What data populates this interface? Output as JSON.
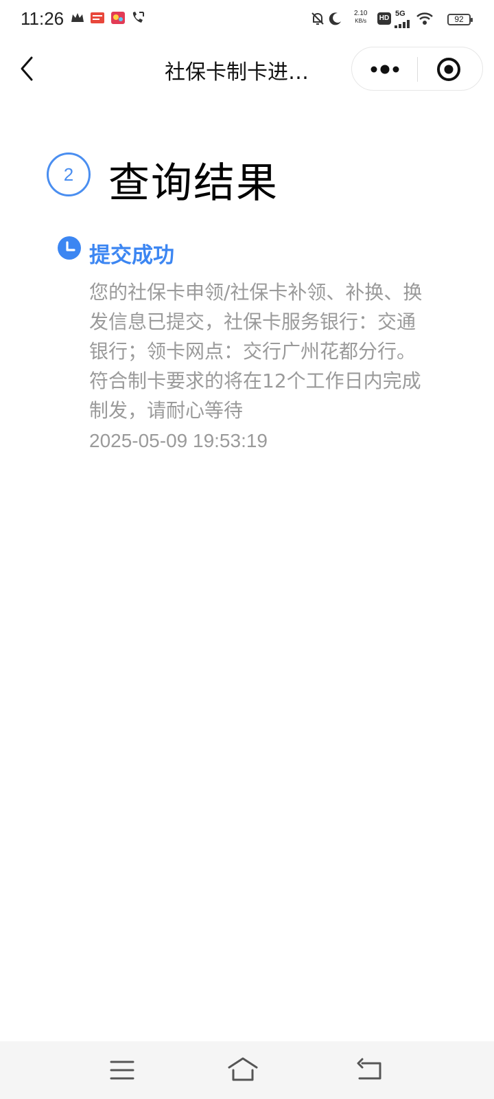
{
  "status_bar": {
    "time": "11:26",
    "net_speed_value": "2.10",
    "net_speed_unit": "KB/s",
    "hd_label": "HD",
    "network_label": "5G",
    "battery": "92"
  },
  "nav": {
    "title": "社保卡制卡进…"
  },
  "step": {
    "number": "2",
    "title": "查询结果"
  },
  "result": {
    "status": "提交成功",
    "description": "您的社保卡申领/社保卡补领、补换、换发信息已提交，社保卡服务银行：交通银行；领卡网点：交行广州花都分行。符合制卡要求的将在12个工作日内完成制发，请耐心等待",
    "timestamp": "2025-05-09 19:53:19"
  },
  "colors": {
    "accent": "#3c86f2",
    "secondary_text": "#9a9a9a"
  },
  "icons": {
    "back": "chevron-left-icon",
    "more": "more-dots-icon",
    "close_mini": "target-icon",
    "timeline": "clock-icon",
    "menu": "menu-icon",
    "home": "home-icon",
    "return": "back-arrow-icon"
  }
}
